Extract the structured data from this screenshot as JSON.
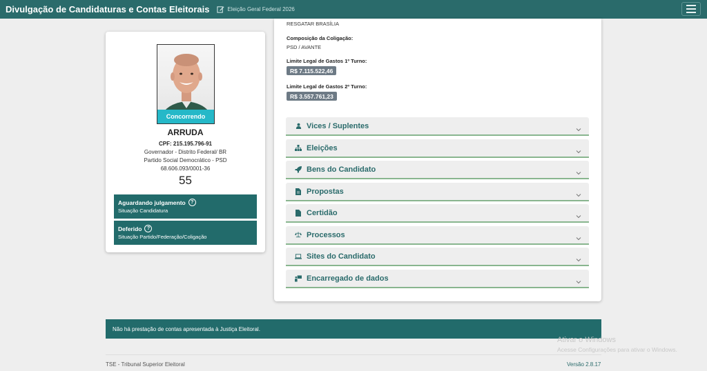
{
  "header": {
    "title": "Divulgação de Candidaturas e Contas Eleitorais",
    "election": "Eleição Geral Federal 2026"
  },
  "candidate": {
    "photo_status": "Concorrendo",
    "name": "ARRUDA",
    "cpf": "CPF: 215.195.796-91",
    "office": "Governador - Distrito Federal/ BR",
    "party": "Partido Social Democrático - PSD",
    "cnpj": "68.606.093/0001-36",
    "number": "55",
    "status_boxes": [
      {
        "title": "Aguardando julgamento",
        "subtitle": "Situação Candidatura"
      },
      {
        "title": "Deferido",
        "subtitle": "Situação Partido/Federação/Coligação"
      }
    ]
  },
  "details": {
    "coalition_name": "RESGATAR BRASÍLIA",
    "coalition_label": "Composição da Coligação:",
    "coalition_value": "PSD / AVANTE",
    "limit1_label": "Limite Legal de Gastos 1º Turno:",
    "limit1_value": "R$ 7.115.522,46",
    "limit2_label": "Limite Legal de Gastos 2º Turno:",
    "limit2_value": "R$ 3.557.761,23"
  },
  "accordion": [
    {
      "label": "Vices / Suplentes",
      "icon": "person-icon"
    },
    {
      "label": "Eleições",
      "icon": "org-chart-icon"
    },
    {
      "label": "Bens do Candidato",
      "icon": "rocket-icon"
    },
    {
      "label": "Propostas",
      "icon": "document-icon"
    },
    {
      "label": "Certidão",
      "icon": "file-icon"
    },
    {
      "label": "Processos",
      "icon": "scale-icon"
    },
    {
      "label": "Sites do Candidato",
      "icon": "laptop-icon"
    },
    {
      "label": "Encarregado de dados",
      "icon": "data-officer-icon"
    }
  ],
  "notice": "Não há prestação de contas apresentada à Justiça Eleitoral.",
  "footer": {
    "org": "TSE - Tribunal Superior Eleitoral",
    "version": "Versão 2.8.17"
  },
  "watermark": {
    "line1": "Ativar o Windows",
    "line2": "Acesse Configurações para ativar o Windows."
  },
  "colors": {
    "header": "#2a6b6b",
    "status_box": "#226b6b",
    "status_pill": "#25b8c8",
    "money_badge": "#6d7a85",
    "accordion_border": "#88b58e"
  }
}
